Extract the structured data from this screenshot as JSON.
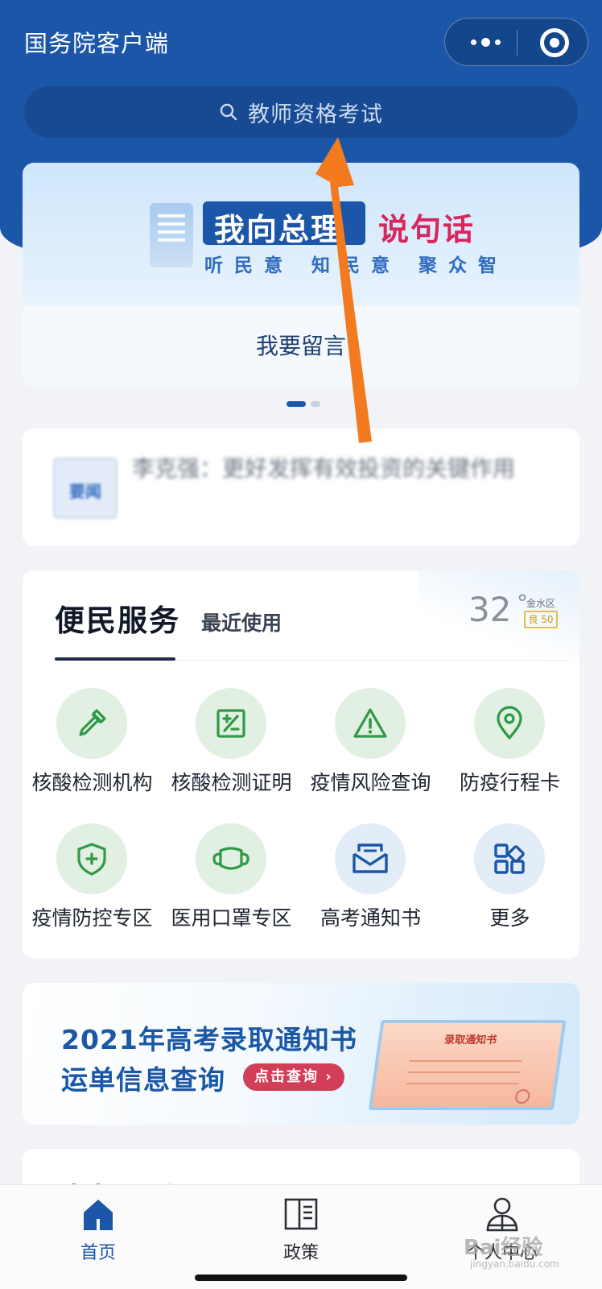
{
  "header": {
    "title": "国务院客户端",
    "search_placeholder": "教师资格考试",
    "menu_icon": "more-dots-icon",
    "close_icon": "target-close-icon"
  },
  "banner": {
    "headline_part1": "我向总理",
    "headline_part2": "说句话",
    "subline": "听民意 知民意 聚众智",
    "cta": "我要留言",
    "pager": {
      "count": 2,
      "active": 1
    }
  },
  "news": {
    "thumb_label": "要闻",
    "title": "李克强：更好发挥有效投资的关键作用"
  },
  "services": {
    "tab_active": "便民服务",
    "tab_recent": "最近使用",
    "weather": {
      "temperature": "32",
      "degree_symbol": "°",
      "location": "金水区",
      "aqi": "良 50"
    },
    "items": [
      {
        "label": "核酸检测机构",
        "icon": "dropper-icon"
      },
      {
        "label": "核酸检测证明",
        "icon": "certificate-icon"
      },
      {
        "label": "疫情风险查询",
        "icon": "warning-icon"
      },
      {
        "label": "防疫行程卡",
        "icon": "location-pin-icon"
      },
      {
        "label": "疫情防控专区",
        "icon": "shield-plus-icon"
      },
      {
        "label": "医用口罩专区",
        "icon": "mask-icon"
      },
      {
        "label": "高考通知书",
        "icon": "envelope-icon"
      },
      {
        "label": "更多",
        "icon": "grid-more-icon"
      }
    ]
  },
  "promo": {
    "line1": "2021年高考录取通知书",
    "line2": "运单信息查询",
    "button": "点击查询 ›",
    "letter_title": "录取通知书"
  },
  "next_section": {
    "title": "政务互动"
  },
  "tabbar": {
    "items": [
      {
        "label": "首页",
        "icon": "home-icon",
        "active": true
      },
      {
        "label": "政策",
        "icon": "book-icon",
        "active": false
      },
      {
        "label": "个人中心",
        "icon": "person-icon",
        "active": false
      }
    ]
  },
  "watermark": {
    "text": "Bai经验",
    "sub": "jingyan.baidu.com"
  },
  "colors": {
    "brand_blue": "#1b56a8",
    "service_green": "#2f9a45",
    "promo_red": "#d23d57",
    "annotation_orange": "#f47a20"
  }
}
